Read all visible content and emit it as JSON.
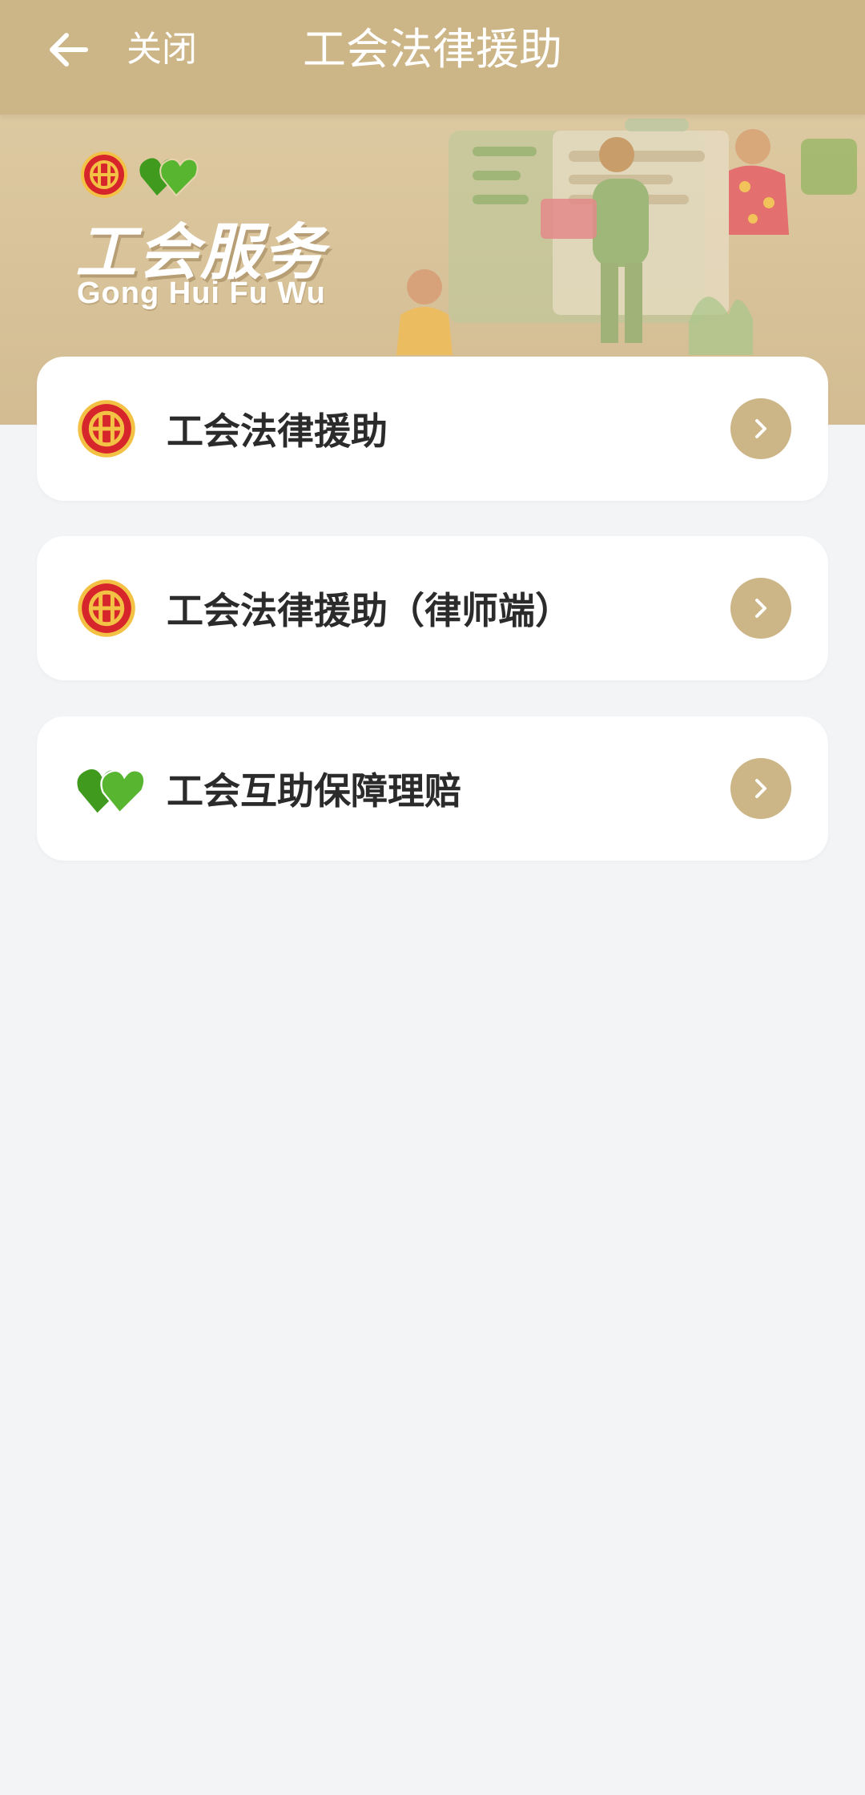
{
  "header": {
    "back_icon": "arrow-left-icon",
    "close_label": "关闭",
    "title": "工会法律援助",
    "bg_color": "#ccb587"
  },
  "banner": {
    "title": "工会服务",
    "subtitle": "Gong Hui Fu Wu",
    "icons": [
      "union-emblem-icon",
      "green-hearts-icon"
    ]
  },
  "services": [
    {
      "label": "工会法律援助",
      "icon": "union-emblem-icon"
    },
    {
      "label": "工会法律援助（律师端）",
      "icon": "union-emblem-icon"
    },
    {
      "label": "工会互助保障理赔",
      "icon": "green-hearts-icon"
    }
  ],
  "colors": {
    "accent": "#ccb587",
    "page_bg": "#f3f4f6",
    "emblem_red": "#d7262b",
    "emblem_gold": "#f3c245",
    "hearts_green": "#3f9a1e"
  }
}
